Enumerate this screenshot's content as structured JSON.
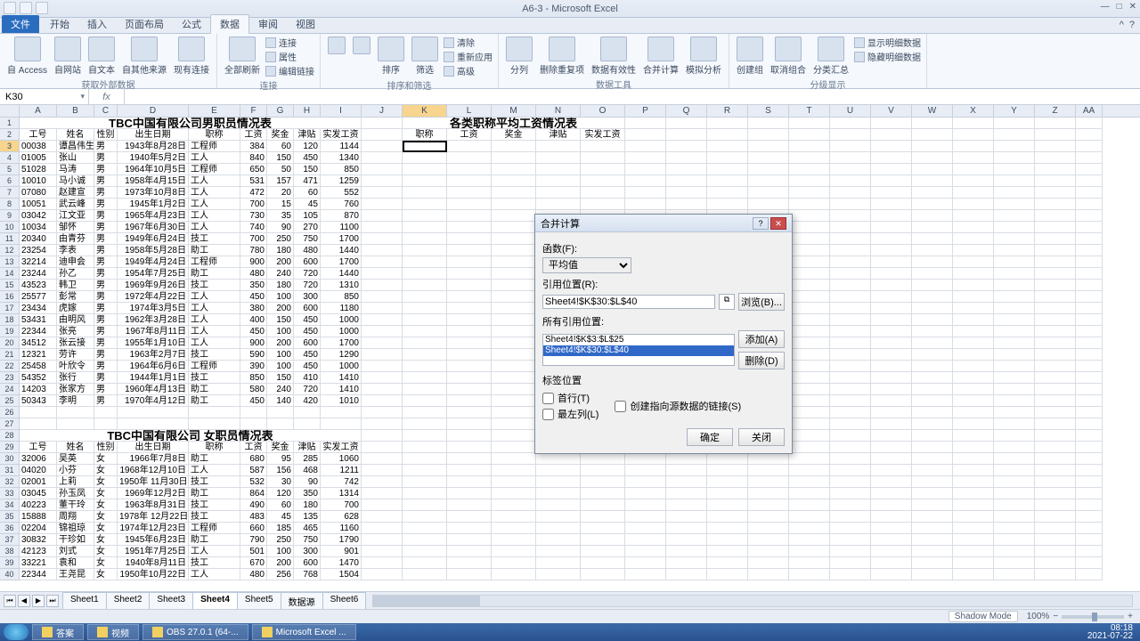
{
  "app": {
    "title": "A6-3 - Microsoft Excel"
  },
  "tabs": {
    "file": "文件",
    "items": [
      "开始",
      "插入",
      "页面布局",
      "公式",
      "数据",
      "审阅",
      "视图"
    ],
    "active_index": 4
  },
  "ribbon": {
    "g1": {
      "label": "获取外部数据",
      "btns": [
        "自 Access",
        "自网站",
        "自文本",
        "自其他来源",
        "现有连接"
      ]
    },
    "g2": {
      "label": "连接",
      "refresh": "全部刷新",
      "lines": [
        "连接",
        "属性",
        "编辑链接"
      ]
    },
    "g3": {
      "label": "排序和筛选",
      "sort": "排序",
      "filter": "筛选",
      "lines": [
        "清除",
        "重新应用",
        "高级"
      ]
    },
    "g4": {
      "label": "数据工具",
      "btns": [
        "分列",
        "删除重复项",
        "数据有效性",
        "合并计算",
        "模拟分析"
      ]
    },
    "g5": {
      "label": "分级显示",
      "btns": [
        "创建组",
        "取消组合",
        "分类汇总"
      ],
      "lines": [
        "显示明细数据",
        "隐藏明细数据"
      ]
    }
  },
  "namebox": "K30",
  "columns": [
    "A",
    "B",
    "C",
    "D",
    "E",
    "F",
    "G",
    "H",
    "I",
    "J",
    "K",
    "L",
    "M",
    "N",
    "O",
    "P",
    "Q",
    "R",
    "S",
    "T",
    "U",
    "V",
    "W",
    "X",
    "Y",
    "Z",
    "AA"
  ],
  "title_male": "TBC中国有限公司男职员情况表",
  "title_summary": "各类职称平均工资情况表",
  "title_female": "TBC中国有限公司 女职员情况表",
  "hdr": [
    "工号",
    "姓名",
    "性别",
    "出生日期",
    "职称",
    "工资",
    "奖金",
    "津贴",
    "实发工资"
  ],
  "hdr2": [
    "职称",
    "工资",
    "奖金",
    "津贴",
    "实发工资"
  ],
  "male_rows": [
    [
      "00038",
      "谭昌伟生",
      "男",
      "1943年8月28日",
      "工程师",
      "384",
      "60",
      "120",
      "1144"
    ],
    [
      "01005",
      "张山",
      "男",
      "1940年5月2日",
      "工人",
      "840",
      "150",
      "450",
      "1340"
    ],
    [
      "51028",
      "马涛",
      "男",
      "1964年10月5日",
      "工程师",
      "650",
      "50",
      "150",
      "850"
    ],
    [
      "10010",
      "马小诚",
      "男",
      "1958年4月15日",
      "工人",
      "531",
      "157",
      "471",
      "1259"
    ],
    [
      "07080",
      "赵建宣",
      "男",
      "1973年10月8日",
      "工人",
      "472",
      "20",
      "60",
      "552"
    ],
    [
      "10051",
      "武云峰",
      "男",
      "1945年1月2日",
      "工人",
      "700",
      "15",
      "45",
      "760"
    ],
    [
      "03042",
      "江文亚",
      "男",
      "1965年4月23日",
      "工人",
      "730",
      "35",
      "105",
      "870"
    ],
    [
      "10034",
      "邹怀",
      "男",
      "1967年6月30日",
      "工人",
      "740",
      "90",
      "270",
      "1100"
    ],
    [
      "20340",
      "由青芬",
      "男",
      "1949年6月24日",
      "技工",
      "700",
      "250",
      "750",
      "1700"
    ],
    [
      "23254",
      "李表",
      "男",
      "1958年5月28日",
      "助工",
      "780",
      "180",
      "480",
      "1440"
    ],
    [
      "32214",
      "迪申会",
      "男",
      "1949年4月24日",
      "工程师",
      "900",
      "200",
      "600",
      "1700"
    ],
    [
      "23244",
      "孙乙",
      "男",
      "1954年7月25日",
      "助工",
      "480",
      "240",
      "720",
      "1440"
    ],
    [
      "43523",
      "韩卫",
      "男",
      "1969年9月26日",
      "技工",
      "350",
      "180",
      "720",
      "1310"
    ],
    [
      "25577",
      "彭常",
      "男",
      "1972年4月22日",
      "工人",
      "450",
      "100",
      "300",
      "850"
    ],
    [
      "23434",
      "虎嫁",
      "男",
      "1974年3月5日",
      "工人",
      "380",
      "200",
      "600",
      "1180"
    ],
    [
      "53431",
      "由明风",
      "男",
      "1962年3月28日",
      "工人",
      "400",
      "150",
      "450",
      "1000"
    ],
    [
      "22344",
      "张亮",
      "男",
      "1967年8月11日",
      "工人",
      "450",
      "100",
      "450",
      "1000"
    ],
    [
      "34512",
      "张云接",
      "男",
      "1955年1月10日",
      "工人",
      "900",
      "200",
      "600",
      "1700"
    ],
    [
      "12321",
      "劳许",
      "男",
      "1963年2月7日",
      "技工",
      "590",
      "100",
      "450",
      "1290"
    ],
    [
      "25458",
      "叶欣令",
      "男",
      "1964年6月6日",
      "工程师",
      "390",
      "100",
      "450",
      "1000"
    ],
    [
      "54352",
      "张行",
      "男",
      "1944年1月1日",
      "技工",
      "850",
      "150",
      "410",
      "1410"
    ],
    [
      "14203",
      "张家方",
      "男",
      "1960年4月13日",
      "助工",
      "580",
      "240",
      "720",
      "1410"
    ],
    [
      "50343",
      "李明",
      "男",
      "1970年4月12日",
      "助工",
      "450",
      "140",
      "420",
      "1010"
    ]
  ],
  "female_hdr": [
    "工号",
    "姓名",
    "性别",
    "出生日期",
    "职称",
    "工资",
    "奖金",
    "津贴",
    "实发工资"
  ],
  "female_rows": [
    [
      "32006",
      "吴英",
      "女",
      "1966年7月8日",
      "助工",
      "680",
      "95",
      "285",
      "1060"
    ],
    [
      "04020",
      "小芬",
      "女",
      "1968年12月10日",
      "工人",
      "587",
      "156",
      "468",
      "1211"
    ],
    [
      "02001",
      "上莉",
      "女",
      "1950年 11月30日",
      "技工",
      "532",
      "30",
      "90",
      "742"
    ],
    [
      "03045",
      "孙玉凤",
      "女",
      "1969年12月2日",
      "助工",
      "864",
      "120",
      "350",
      "1314"
    ],
    [
      "40223",
      "董干玲",
      "女",
      "1963年8月31日",
      "技工",
      "490",
      "60",
      "180",
      "700"
    ],
    [
      "15888",
      "周翔",
      "女",
      "1978年 12月22日",
      "技工",
      "483",
      "45",
      "135",
      "628"
    ],
    [
      "02204",
      "锦祖琼",
      "女",
      "1974年12月23日",
      "工程师",
      "660",
      "185",
      "465",
      "1160"
    ],
    [
      "30832",
      "干珍如",
      "女",
      "1945年6月23日",
      "助工",
      "790",
      "250",
      "750",
      "1790"
    ],
    [
      "42123",
      "刘式",
      "女",
      "1951年7月25日",
      "工人",
      "501",
      "100",
      "300",
      "901"
    ],
    [
      "33221",
      "袁和",
      "女",
      "1940年8月11日",
      "技工",
      "670",
      "200",
      "600",
      "1470"
    ],
    [
      "22344",
      "王尧昆",
      "女",
      "1950年10月22日",
      "工人",
      "480",
      "256",
      "768",
      "1504"
    ]
  ],
  "dialog": {
    "title": "合并计算",
    "fn_label": "函数(F):",
    "fn_value": "平均值",
    "ref_label": "引用位置(R):",
    "ref_value": "Sheet4!$K$30:$L$40",
    "all_label": "所有引用位置:",
    "refs": [
      "Sheet4!$K$3:$L$25",
      "Sheet4!$K$30:$L$40"
    ],
    "browse": "浏览(B)...",
    "add": "添加(A)",
    "delete": "删除(D)",
    "pos_label": "标签位置",
    "top_row": "首行(T)",
    "left_col": "最左列(L)",
    "link": "创建指向源数据的链接(S)",
    "ok": "确定",
    "cancel": "关闭"
  },
  "sheets": {
    "items": [
      "Sheet1",
      "Sheet2",
      "Sheet3",
      "Sheet4",
      "Sheet5",
      "数据源",
      "Sheet6"
    ],
    "active_index": 3
  },
  "statusbar": {
    "shadow": "Shadow Mode",
    "zoom": "100%"
  },
  "taskbar": {
    "items": [
      "答案",
      "视频",
      "OBS 27.0.1 (64-...",
      "Microsoft Excel ..."
    ],
    "time": "08:18",
    "date": "2021-07-22"
  }
}
